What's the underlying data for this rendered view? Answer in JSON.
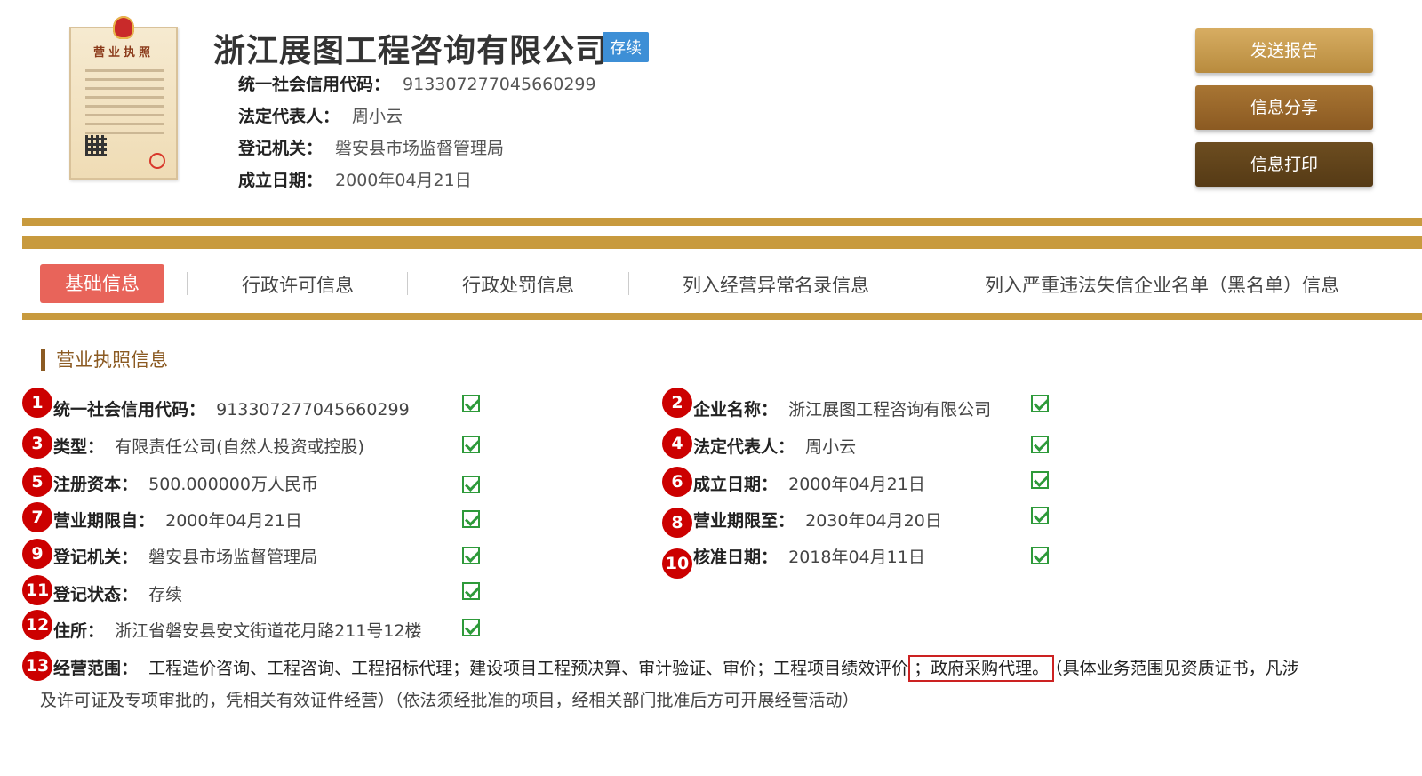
{
  "license_image": {
    "title": "营业执照"
  },
  "header": {
    "company_name": "浙江展图工程咨询有限公司",
    "status": "存续",
    "credit_code_label": "统一社会信用代码：",
    "credit_code": "913307277045660299",
    "legal_rep_label": "法定代表人：",
    "legal_rep": "周小云",
    "authority_label": "登记机关：",
    "authority": "磐安县市场监督管理局",
    "founded_label": "成立日期：",
    "founded": "2000年04月21日"
  },
  "buttons": {
    "send_report": "发送报告",
    "share": "信息分享",
    "print": "信息打印"
  },
  "tabs": [
    {
      "label": "基础信息",
      "active": true
    },
    {
      "label": "行政许可信息"
    },
    {
      "label": "行政处罚信息"
    },
    {
      "label": "列入经营异常名录信息"
    },
    {
      "label": "列入严重违法失信企业名单（黑名单）信息"
    }
  ],
  "section_title": "营业执照信息",
  "fields": [
    {
      "num": "1",
      "label": "统一社会信用代码：",
      "value": "913307277045660299"
    },
    {
      "num": "2",
      "label": "企业名称：",
      "value": "浙江展图工程咨询有限公司"
    },
    {
      "num": "3",
      "label": "类型：",
      "value": "有限责任公司(自然人投资或控股)"
    },
    {
      "num": "4",
      "label": "法定代表人：",
      "value": "周小云"
    },
    {
      "num": "5",
      "label": "注册资本：",
      "value": "500.000000万人民币"
    },
    {
      "num": "6",
      "label": "成立日期：",
      "value": "2000年04月21日"
    },
    {
      "num": "7",
      "label": "营业期限自：",
      "value": "2000年04月21日"
    },
    {
      "num": "8",
      "label": "营业期限至：",
      "value": "2030年04月20日"
    },
    {
      "num": "9",
      "label": "登记机关：",
      "value": "磐安县市场监督管理局"
    },
    {
      "num": "10",
      "label": "核准日期：",
      "value": "2018年04月11日"
    },
    {
      "num": "11",
      "label": "登记状态：",
      "value": "存续"
    },
    {
      "num": "12",
      "label": "住所：",
      "value": "浙江省磐安县安文街道花月路211号12楼"
    }
  ],
  "scope": {
    "num": "13",
    "label": "经营范围：",
    "text_part1": "工程造价咨询、工程咨询、工程招标代理；建设项目工程预决算、审计验证、审价；工程项目绩效评价",
    "highlight": "；政府采购代理。",
    "text_part2": "（具体业务范围见资质证书，凡涉",
    "text_line2": "及许可证及专项审批的，凭相关有效证件经营）（依法须经批准的项目，经相关部门批准后方可开展经营活动）"
  },
  "colors": {
    "accent_gold": "#c89a3e",
    "active_tab": "#e8645a",
    "badge_red": "#cc0000",
    "check_green": "#2e9a3a",
    "status_blue": "#3d8fd6"
  }
}
